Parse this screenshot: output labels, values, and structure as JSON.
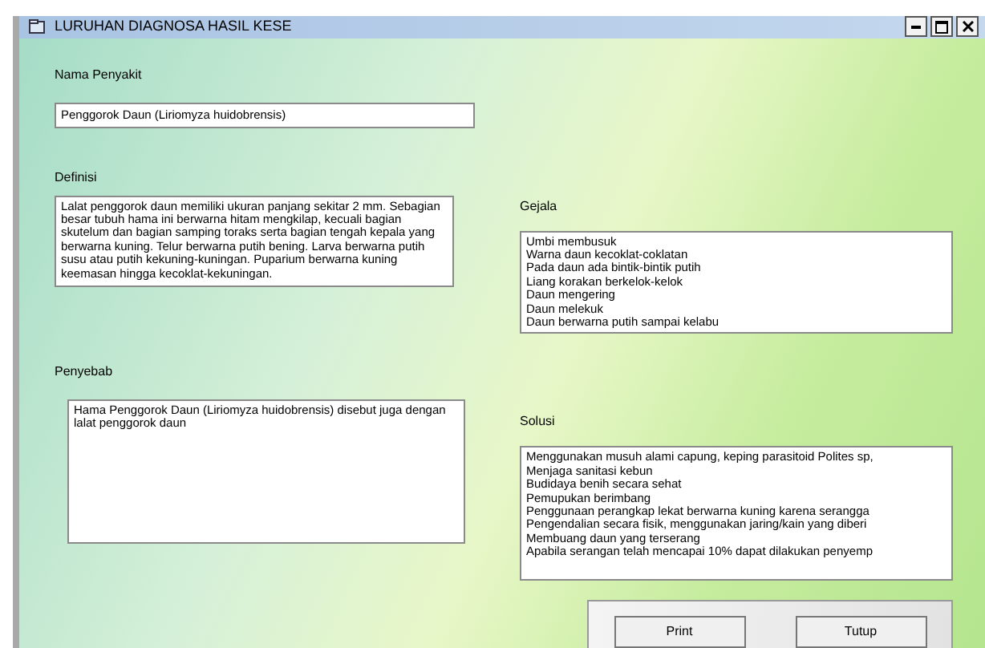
{
  "window": {
    "title": "LURUHAN DIAGNOSA  HASIL KESE"
  },
  "nama_penyakit": {
    "label": "Nama Penyakit",
    "value": "Penggorok Daun (Liriomyza huidobrensis)"
  },
  "definisi": {
    "label": "Definisi",
    "text": "Lalat penggorok daun memiliki ukuran panjang sekitar 2 mm. Sebagian besar tubuh hama ini berwarna hitam mengkilap, kecuali bagian skutelum dan bagian samping toraks serta bagian tengah kepala yang berwarna kuning. Telur berwarna putih bening. Larva berwarna putih susu atau putih kekuning-kuningan. Puparium berwarna kuning keemasan hingga kecoklat-kekuningan."
  },
  "gejala": {
    "label": "Gejala",
    "items": [
      "Umbi membusuk",
      "Warna daun kecoklat-coklatan",
      "Pada daun ada bintik-bintik putih",
      "Liang korakan berkelok-kelok",
      "Daun mengering",
      "Daun melekuk",
      "Daun berwarna putih sampai kelabu"
    ]
  },
  "penyebab": {
    "label": "Penyebab",
    "text": "Hama Penggorok Daun (Liriomyza huidobrensis) disebut juga dengan lalat penggorok daun"
  },
  "solusi": {
    "label": "Solusi",
    "items": [
      "Menggunakan musuh alami capung, keping parasitoid Polites sp,",
      "Menjaga sanitasi kebun",
      "Budidaya benih secara sehat",
      "Pemupukan berimbang",
      "Penggunaan perangkap lekat berwarna kuning karena serangga",
      "Pengendalian secara fisik, menggunakan jaring/kain yang diberi",
      "Membuang daun yang terserang",
      "Apabila serangan telah mencapai 10% dapat dilakukan penyemp"
    ]
  },
  "buttons": [
    "Print",
    "Tutup"
  ]
}
